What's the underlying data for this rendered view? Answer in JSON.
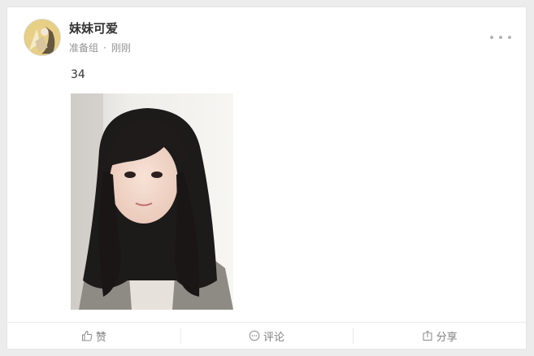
{
  "post": {
    "username": "妹妹可爱",
    "group": "准备组",
    "separator": "·",
    "time": "刚刚",
    "text": "34"
  },
  "actions": {
    "like_label": "赞",
    "comment_label": "评论",
    "share_label": "分享"
  },
  "icons": {
    "more": "more-dots-icon",
    "like": "thumbs-up-icon",
    "comment": "comment-bubble-icon",
    "share": "share-icon"
  },
  "colors": {
    "username": "#333333",
    "meta": "#939393",
    "action": "#808080",
    "divider": "#eaeaea"
  }
}
